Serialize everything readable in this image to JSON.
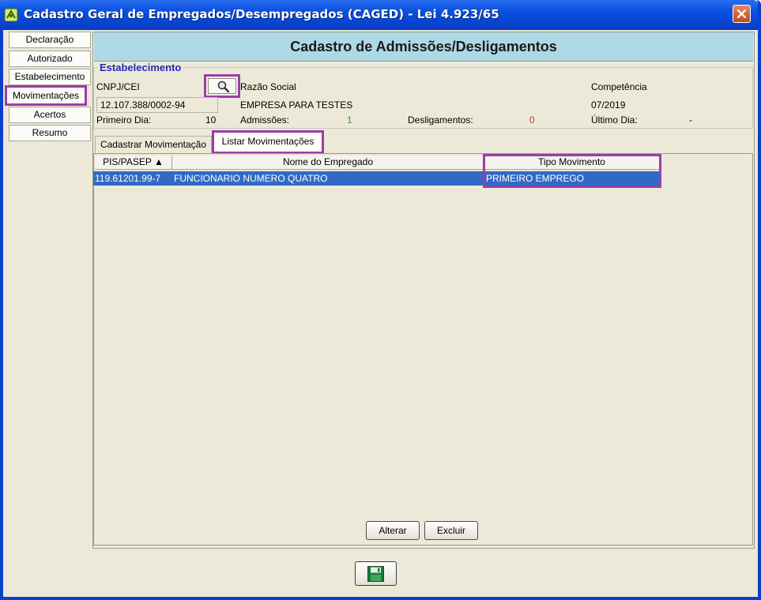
{
  "window": {
    "title": "Cadastro Geral de Empregados/Desempregados (CAGED) - Lei 4.923/65"
  },
  "sidebar": {
    "items": [
      {
        "label": "Declaração"
      },
      {
        "label": "Autorizado"
      },
      {
        "label": "Estabelecimento"
      },
      {
        "label": "Movimentações",
        "active": true
      },
      {
        "label": "Acertos"
      },
      {
        "label": "Resumo"
      }
    ]
  },
  "header": {
    "title": "Cadastro de Admissões/Desligamentos"
  },
  "estabelecimento": {
    "legend": "Estabelecimento",
    "cnpj_label": "CNPJ/CEI",
    "cnpj_value": "12.107.388/0002-94",
    "razao_label": "Razão Social",
    "razao_value": "EMPRESA PARA TESTES",
    "competencia_label": "Competência",
    "competencia_value": "07/2019",
    "primeiro_dia_label": "Primeiro Dia:",
    "primeiro_dia_value": "10",
    "admissoes_label": "Admissões:",
    "admissoes_value": "1",
    "desligamentos_label": "Desligamentos:",
    "desligamentos_value": "0",
    "ultimo_dia_label": "Último Dia:",
    "ultimo_dia_value": "-"
  },
  "tabs": [
    {
      "label": "Cadastrar Movimentação"
    },
    {
      "label": "Listar Movimentações",
      "selected": true
    }
  ],
  "table": {
    "columns": [
      "PIS/PASEP ▲",
      "Nome do Empregado",
      "Tipo Movimento"
    ],
    "rows": [
      {
        "pis": "119.61201.99-7",
        "nome": "FUNCIONARIO NUMERO QUATRO",
        "tipo": "PRIMEIRO EMPREGO"
      }
    ]
  },
  "buttons": {
    "alterar": "Alterar",
    "excluir": "Excluir"
  },
  "colors": {
    "highlight": "#9b3fa6",
    "header_bg": "#add8e6",
    "selection": "#316ac5",
    "admissoes": "#2a9d2a",
    "desligamentos": "#c0392b"
  },
  "icons": {
    "search": "magnifier-icon",
    "save": "floppy-disk-icon",
    "close": "close-icon",
    "app": "caged-app-icon"
  }
}
